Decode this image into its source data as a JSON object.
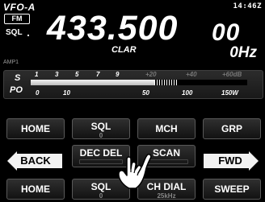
{
  "header": {
    "radio_name": "VFO-A",
    "clock": "14:46Z",
    "mode": "FM",
    "sql_label": "SQL"
  },
  "frequency": {
    "main": "433.500",
    "small": "00"
  },
  "clarifier": {
    "label": "CLAR",
    "offset": "0Hz"
  },
  "amp_label": "AMP1",
  "meter": {
    "s_label": "S",
    "po_label": "PO",
    "s_scale": [
      "1",
      "3",
      "5",
      "7",
      "9"
    ],
    "s_scale_over": [
      "+20",
      "+40",
      "+60dB"
    ],
    "po_scale": [
      "0",
      "10",
      "50",
      "100",
      "150W"
    ],
    "s_level_fraction": 0.58
  },
  "keys": {
    "row1": [
      {
        "label": "HOME",
        "sub": ""
      },
      {
        "label": "SQL",
        "sub": "0"
      },
      {
        "label": "MCH",
        "sub": ""
      },
      {
        "label": "GRP",
        "sub": ""
      }
    ],
    "row2": {
      "back": "BACK",
      "dec_del": "DEC DEL",
      "scan": "SCAN",
      "fwd": "FWD"
    },
    "row3": [
      {
        "label": "HOME",
        "sub": ""
      },
      {
        "label": "SQL",
        "sub": "0"
      },
      {
        "label": "CH DIAL",
        "sub": "25kHz"
      },
      {
        "label": "SWEEP",
        "sub": ""
      }
    ]
  },
  "colors": {
    "background": "#000000",
    "text": "#ffffff",
    "key_border": "#595959",
    "nav_arrow": "#f2f2f2"
  },
  "icons": {
    "touch_hand": "pointing-hand-icon",
    "back_arrow": "arrow-left-icon",
    "fwd_arrow": "arrow-right-icon"
  }
}
